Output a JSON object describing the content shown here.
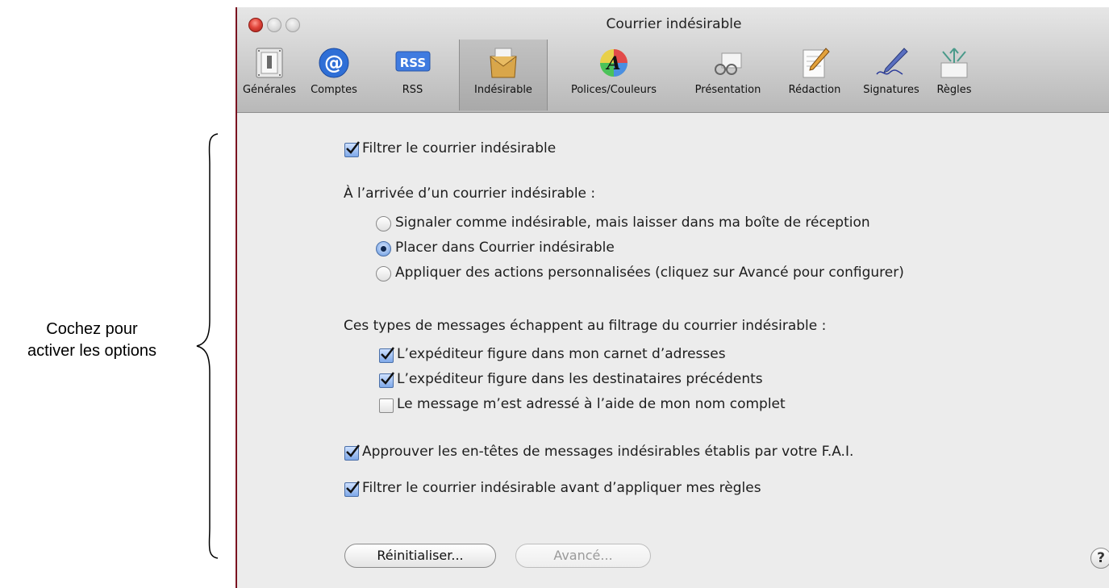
{
  "annotation": {
    "line1": "Cochez pour",
    "line2": "activer les options"
  },
  "window": {
    "title": "Courrier indésirable"
  },
  "toolbar": [
    {
      "label": "Générales",
      "icon": "switch-icon"
    },
    {
      "label": "Comptes",
      "icon": "at-sign-icon"
    },
    {
      "label": "RSS",
      "icon": "rss-icon"
    },
    {
      "label": "Indésirable",
      "icon": "junk-mail-icon",
      "selected": true
    },
    {
      "label": "Polices/Couleurs",
      "icon": "color-wheel-icon"
    },
    {
      "label": "Présentation",
      "icon": "glasses-icon"
    },
    {
      "label": "Rédaction",
      "icon": "pencil-note-icon"
    },
    {
      "label": "Signatures",
      "icon": "pen-signature-icon"
    },
    {
      "label": "Règles",
      "icon": "rules-arrows-icon"
    }
  ],
  "junk": {
    "enable_filter": {
      "label": "Filtrer le courrier indésirable",
      "checked": true
    },
    "on_arrival_heading": "À l’arrivée d’un courrier indésirable :",
    "arrival_options": [
      {
        "label": "Signaler comme indésirable, mais laisser dans ma boîte de réception",
        "selected": false
      },
      {
        "label": "Placer dans Courrier indésirable",
        "selected": true
      },
      {
        "label": "Appliquer des actions personnalisées (cliquez sur Avancé pour configurer)",
        "selected": false
      }
    ],
    "exempt_heading": "Ces types de messages échappent au filtrage du courrier indésirable :",
    "exempt_options": [
      {
        "label": "L’expéditeur figure dans mon carnet d’adresses",
        "checked": true
      },
      {
        "label": "L’expéditeur figure dans les destinataires précédents",
        "checked": true
      },
      {
        "label": "Le message m’est adressé à l’aide de mon nom complet",
        "checked": false
      }
    ],
    "trust_isp": {
      "label": "Approuver les en-têtes de messages indésirables établis par votre F.A.I.",
      "checked": true
    },
    "filter_before_rules": {
      "label": "Filtrer le courrier indésirable avant d’appliquer mes règles",
      "checked": true
    }
  },
  "buttons": {
    "reset": "Réinitialiser...",
    "advanced": "Avancé...",
    "help": "?"
  },
  "colors": {
    "accent": "#4a6fa8",
    "close": "#e0443a"
  }
}
